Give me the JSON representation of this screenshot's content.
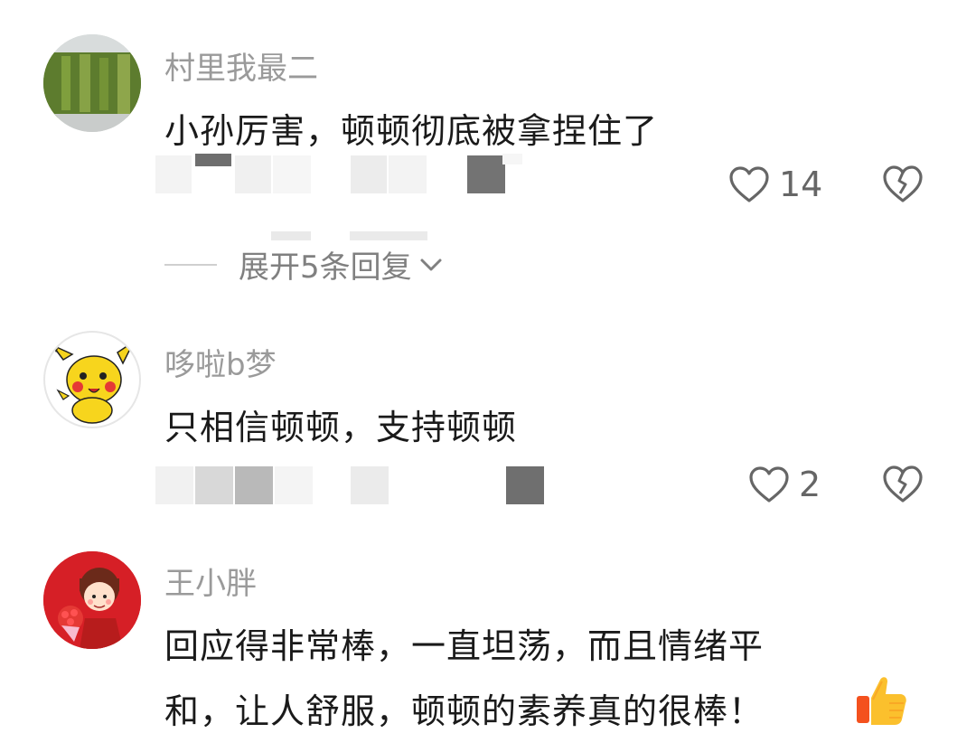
{
  "comments": [
    {
      "username": "村里我最二",
      "text": "小孙厉害，顿顿彻底被拿捏住了",
      "likes": "14",
      "expand": "展开5条回复"
    },
    {
      "username": "哆啦b梦",
      "text": "只相信顿顿，支持顿顿",
      "likes": "2"
    },
    {
      "username": "王小胖",
      "text_line1": "回应得非常棒，一直坦荡，而且情绪平",
      "text_line2": "和，让人舒服，顿顿的素养真的很棒！"
    }
  ],
  "icons": {
    "like": "heart-outline-icon",
    "dislike": "broken-heart-icon",
    "expand": "chevron-down-icon",
    "emoji": "thumbs-up-emoji"
  },
  "colors": {
    "username": "#9a9a9a",
    "text": "#1a1a1a",
    "icon": "#666666"
  }
}
